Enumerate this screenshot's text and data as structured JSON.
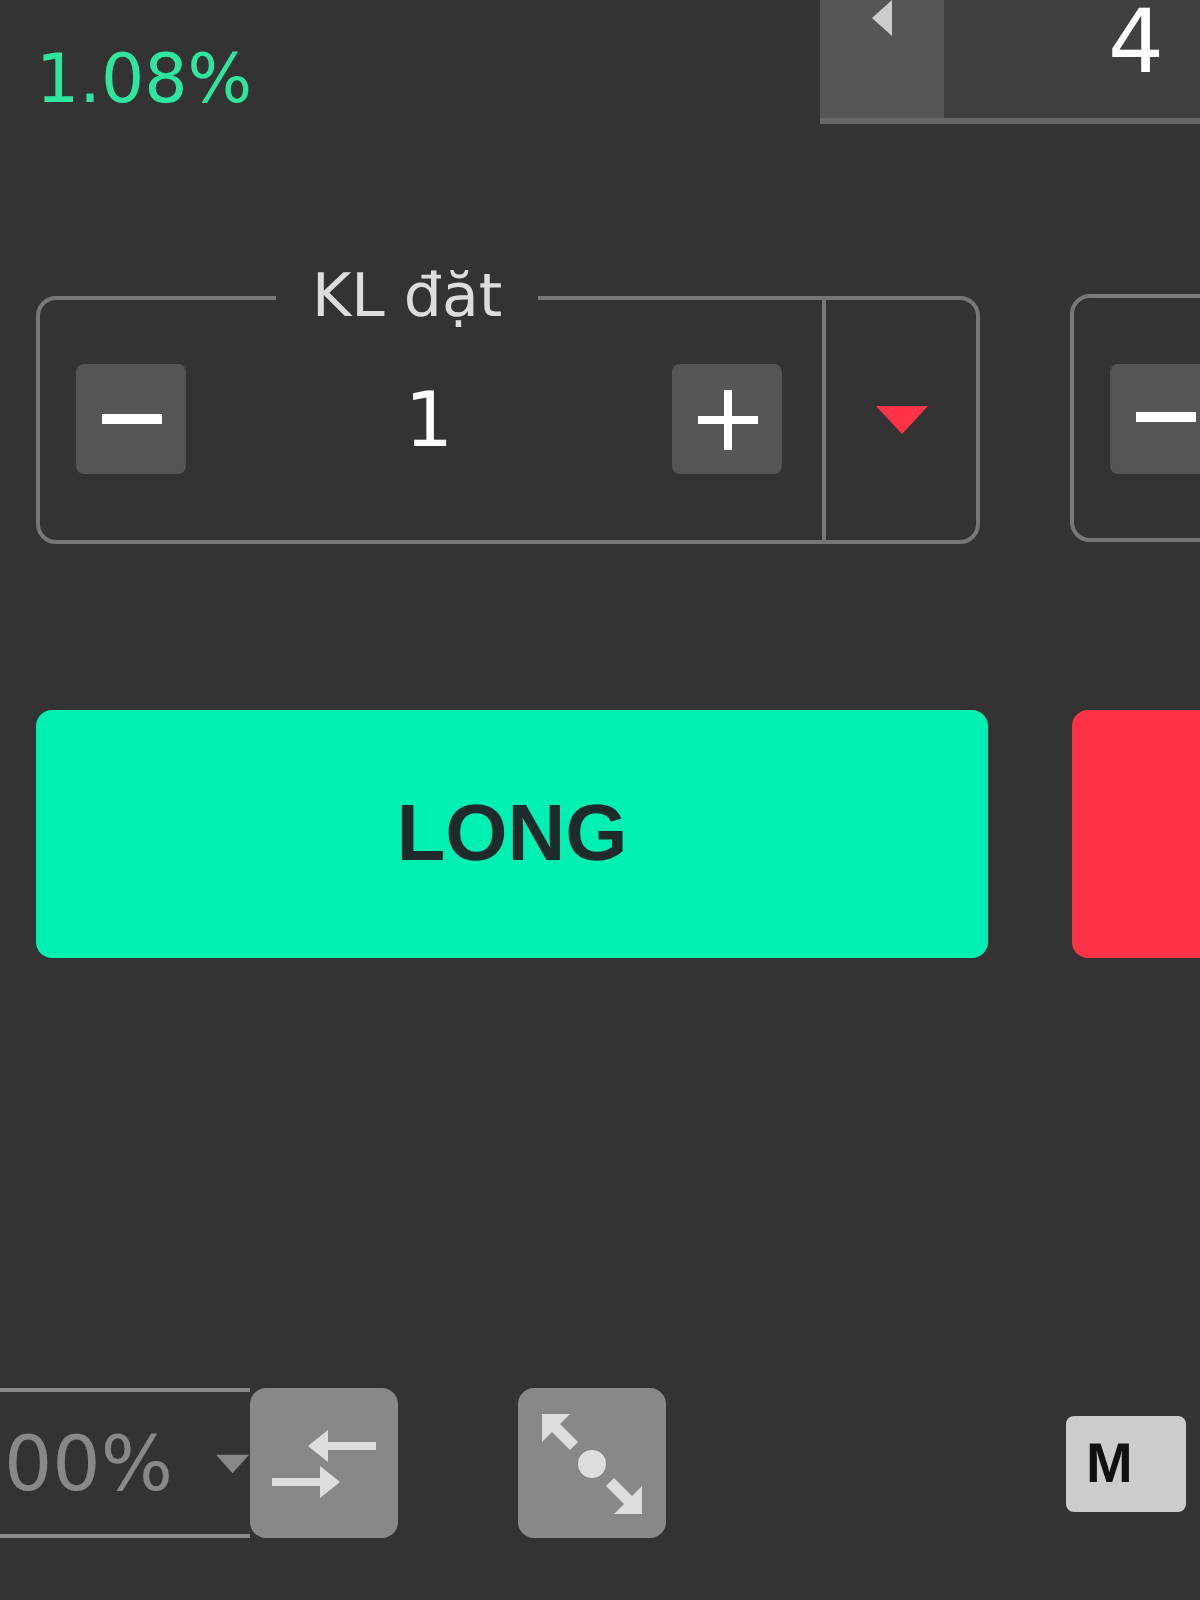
{
  "change": "1.08%",
  "top_stepper": {
    "value": "4"
  },
  "order_quantity": {
    "label": "KL đặt",
    "value": "1"
  },
  "actions": [
    {
      "kind": "long",
      "label": "LONG"
    },
    {
      "kind": "short"
    }
  ],
  "leverage": {
    "value": "00%"
  },
  "badge": "M"
}
